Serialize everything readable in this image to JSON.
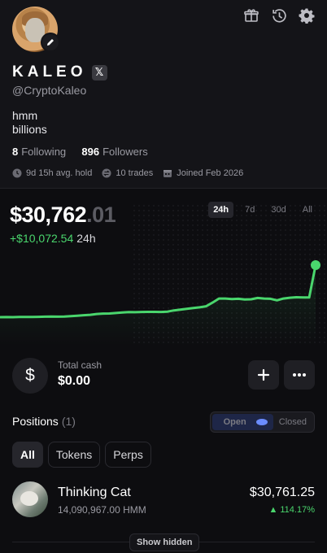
{
  "profile": {
    "name": "KALEO",
    "x_badge": "𝕏",
    "handle": "@CryptoKaleo",
    "bio_line1": "hmm",
    "bio_line2": "billions",
    "following_count": "8",
    "following_label": "Following",
    "followers_count": "896",
    "followers_label": "Followers",
    "avg_hold": "9d 15h avg. hold",
    "trades": "10 trades",
    "joined": "Joined Feb 2026"
  },
  "icons": {
    "gift": "gift-icon",
    "history": "history-icon",
    "settings": "gear-icon",
    "edit": "pencil-icon"
  },
  "balance": {
    "main": "$30,762",
    "cents": ".01",
    "change": "+$10,072.54",
    "period": "24h"
  },
  "ranges": [
    "24h",
    "7d",
    "30d",
    "All"
  ],
  "active_range": "24h",
  "chart_data": {
    "type": "line",
    "x": [
      0,
      1,
      2,
      3,
      4,
      5,
      6,
      7,
      8,
      9,
      10,
      11,
      12,
      13,
      14,
      15,
      16,
      17,
      18,
      19,
      20,
      21,
      22,
      23,
      24,
      25,
      26,
      27,
      28,
      29,
      30,
      31,
      32,
      33,
      34,
      35,
      36,
      37,
      38,
      39,
      40,
      41,
      42,
      43,
      44,
      45,
      46,
      47,
      48,
      49
    ],
    "values": [
      20690,
      20700,
      20690,
      20720,
      20740,
      20730,
      20760,
      20790,
      20800,
      20780,
      20820,
      20900,
      20980,
      21060,
      21150,
      21300,
      21380,
      21400,
      21500,
      21600,
      21680,
      21650,
      21700,
      21720,
      21720,
      21700,
      21760,
      22000,
      22150,
      22300,
      22450,
      22600,
      22800,
      23500,
      24300,
      24300,
      24200,
      24250,
      24100,
      24150,
      24400,
      24300,
      24250,
      23950,
      24300,
      24450,
      24550,
      24500,
      24500,
      30762
    ],
    "color": "#4ad66d",
    "grid": false
  },
  "cash": {
    "label": "Total cash",
    "value": "$0.00",
    "symbol": "$"
  },
  "positions": {
    "title": "Positions",
    "count": "(1)",
    "toggle_open": "Open",
    "toggle_closed": "Closed",
    "tabs": [
      "All",
      "Tokens",
      "Perps"
    ],
    "items": [
      {
        "name": "Thinking Cat",
        "qty": "14,090,967.00 HMM",
        "value": "$30,761.25",
        "pct": "▲ 114.17%"
      }
    ],
    "show_hidden": "Show hidden"
  }
}
